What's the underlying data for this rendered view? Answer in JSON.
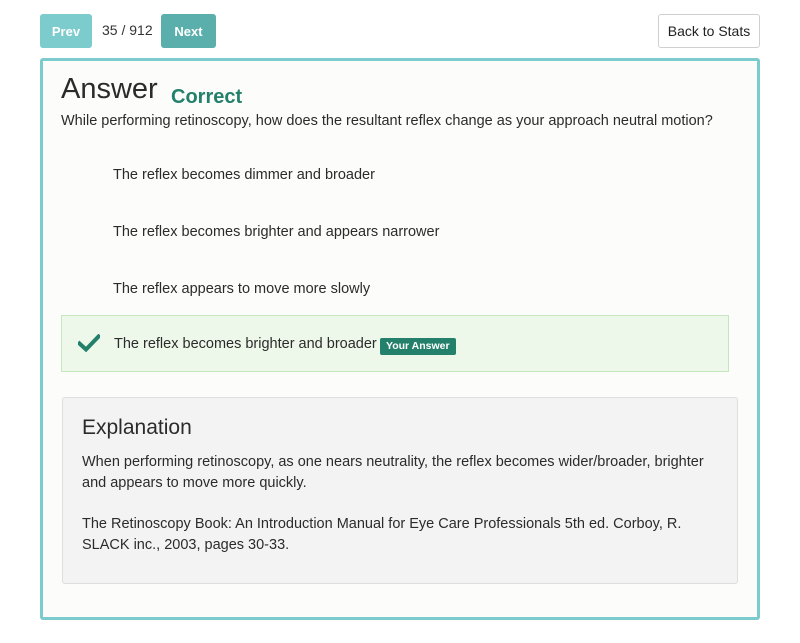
{
  "nav": {
    "prev_label": "Prev",
    "counter": "35 / 912",
    "next_label": "Next",
    "back_label": "Back to Stats"
  },
  "answer": {
    "heading": "Answer",
    "result": "Correct",
    "question": "While performing retinoscopy, how does the resultant reflex change as your approach neutral motion?",
    "choices": [
      "The reflex becomes dimmer and broader",
      "The reflex becomes brighter and appears narrower",
      "The reflex appears to move more slowly"
    ],
    "selected_choice": "The reflex becomes brighter and broader",
    "selected_badge": "Your Answer"
  },
  "explanation": {
    "title": "Explanation",
    "body": "When performing retinoscopy, as one nears neutrality, the reflex becomes wider/broader, brighter and appears to move more quickly.",
    "reference": "The Retinoscopy Book: An Introduction Manual for Eye Care Professionals 5th ed. Corboy, R. SLACK inc., 2003, pages 30-33."
  },
  "colors": {
    "accent_teal": "#7ccbcd",
    "correct_green": "#23806a",
    "correct_bg": "#eef8ea"
  }
}
